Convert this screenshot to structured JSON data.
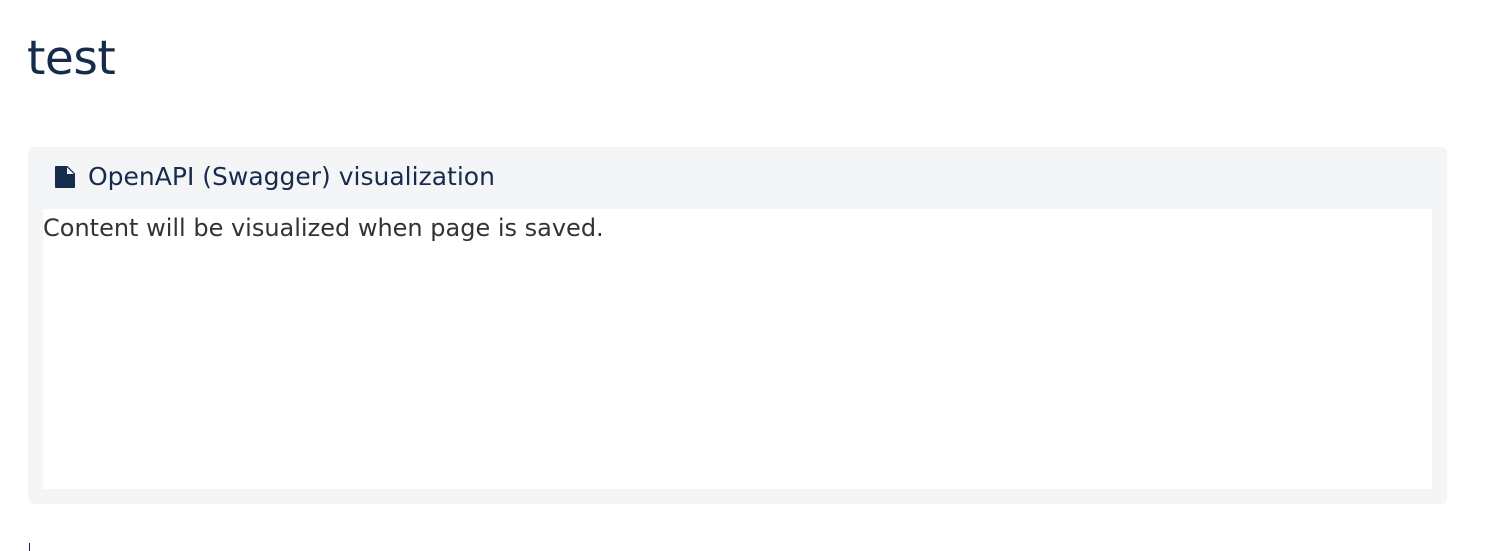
{
  "page": {
    "title": "test"
  },
  "macro": {
    "icon": "document-icon",
    "title": "OpenAPI (Swagger) visualization",
    "placeholder": "Content will be visualized when page is saved."
  },
  "colors": {
    "title_text": "#172b4d",
    "panel_background": "#f4f5f7",
    "body_text": "#333333",
    "icon_fill": "#172b4d"
  }
}
